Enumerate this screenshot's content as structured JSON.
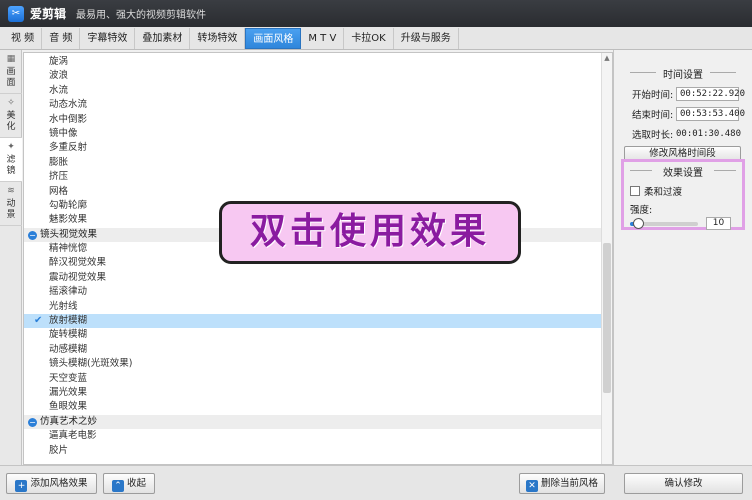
{
  "app": {
    "logo_glyph": "✂",
    "name": "爱剪辑",
    "slogan": "最易用、强大的视频剪辑软件"
  },
  "tabs": [
    {
      "label": "视  频",
      "active": false
    },
    {
      "label": "音  频",
      "active": false
    },
    {
      "label": "字幕特效",
      "active": false
    },
    {
      "label": "叠加素材",
      "active": false
    },
    {
      "label": "转场特效",
      "active": false
    },
    {
      "label": "画面风格",
      "active": true
    },
    {
      "label": "M T V",
      "active": false
    },
    {
      "label": "卡拉OK",
      "active": false
    },
    {
      "label": "升级与服务",
      "active": false
    }
  ],
  "side_tabs": [
    {
      "label": "画面",
      "icon": "picture-icon",
      "glyph": "▦",
      "active": false
    },
    {
      "label": "美化",
      "icon": "wand-icon",
      "glyph": "✧",
      "active": false
    },
    {
      "label": "滤镜",
      "icon": "filter-icon",
      "glyph": "✦",
      "active": true
    },
    {
      "label": "动景",
      "icon": "waves-icon",
      "glyph": "≋",
      "active": false
    }
  ],
  "effect_list": [
    {
      "type": "item",
      "label": "旋涡"
    },
    {
      "type": "item",
      "label": "波浪"
    },
    {
      "type": "item",
      "label": "水流"
    },
    {
      "type": "item",
      "label": "动态水流"
    },
    {
      "type": "item",
      "label": "水中倒影"
    },
    {
      "type": "item",
      "label": "镜中像"
    },
    {
      "type": "item",
      "label": "多重反射"
    },
    {
      "type": "item",
      "label": "膨胀"
    },
    {
      "type": "item",
      "label": "挤压"
    },
    {
      "type": "item",
      "label": "网格"
    },
    {
      "type": "item",
      "label": "勾勒轮廓"
    },
    {
      "type": "item",
      "label": "魅影效果"
    },
    {
      "type": "group",
      "label": "镜头视觉效果"
    },
    {
      "type": "item",
      "label": "精神恍惚"
    },
    {
      "type": "item",
      "label": "醉汉视觉效果"
    },
    {
      "type": "item",
      "label": "震动视觉效果"
    },
    {
      "type": "item",
      "label": "摇滚律动"
    },
    {
      "type": "item",
      "label": "光射线"
    },
    {
      "type": "selected",
      "label": "放射模糊"
    },
    {
      "type": "item",
      "label": "旋转模糊"
    },
    {
      "type": "item",
      "label": "动感模糊"
    },
    {
      "type": "item",
      "label": "镜头模糊(光斑效果)"
    },
    {
      "type": "item",
      "label": "天空变蓝"
    },
    {
      "type": "item",
      "label": "漏光效果"
    },
    {
      "type": "item",
      "label": "鱼眼效果"
    },
    {
      "type": "group",
      "label": "仿真艺术之妙"
    },
    {
      "type": "item",
      "label": "逼真老电影"
    },
    {
      "type": "item",
      "label": "胶片"
    }
  ],
  "overlay_text": "双击使用效果",
  "time_settings": {
    "title": "时间设置",
    "start_label": "开始时间:",
    "start_value": "00:52:22.920",
    "end_label": "结束时间:",
    "end_value": "00:53:53.400",
    "duration_label": "选取时长:",
    "duration_value": "00:01:30.480",
    "modify_button": "修改风格时间段"
  },
  "effect_settings": {
    "title": "效果设置",
    "soft_transition_label": "柔和过渡",
    "soft_transition_checked": false,
    "strength_label": "强度:",
    "strength_value": "10",
    "strength_fraction": 0.12
  },
  "bottom": {
    "add_button": "添加风格效果",
    "collapse_button": "收起",
    "delete_button": "删除当前风格",
    "confirm_button": "确认修改"
  }
}
